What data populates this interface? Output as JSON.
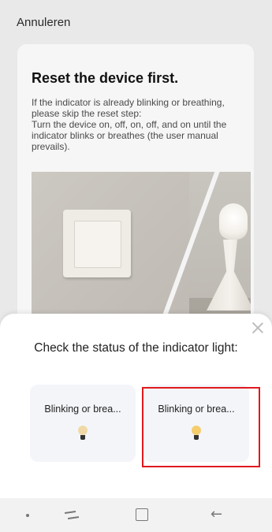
{
  "header": {
    "cancel_label": "Annuleren"
  },
  "instruction_card": {
    "title": "Reset the device first.",
    "body": "If the indicator is already blinking or breathing, please skip the reset step:\nTurn the device on, off, on, off, and on until the indicator blinks or breathes (the user manual prevails)."
  },
  "sheet": {
    "title": "Check the status of the indicator light:",
    "options": [
      {
        "label": "Blinking or brea...",
        "icon": "lightbulb-icon",
        "selected": false
      },
      {
        "label": "Blinking or brea...",
        "icon": "lightbulb-icon",
        "selected": true
      }
    ],
    "close_icon": "close-icon",
    "highlight_color": "#e0191e"
  },
  "navbar": {
    "icons": [
      "dot-icon",
      "recent-apps-icon",
      "home-icon",
      "back-icon"
    ],
    "back_glyph": "←"
  }
}
